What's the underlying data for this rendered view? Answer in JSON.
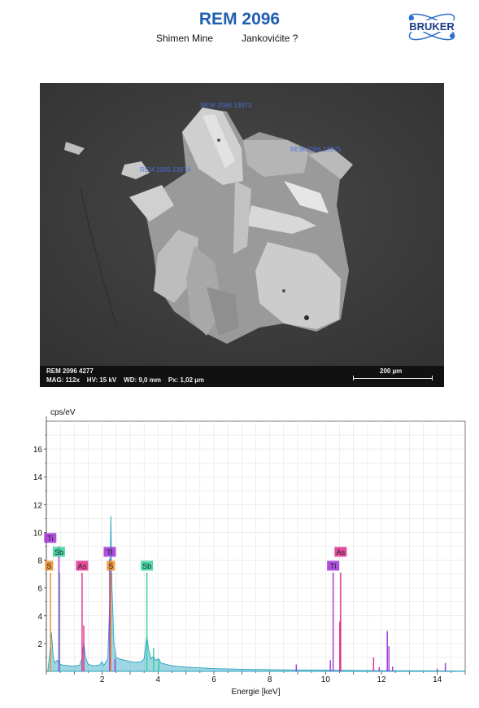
{
  "header": {
    "title": "REM 2096",
    "locality": "Shimen Mine",
    "mineral": "Jankovićite ?",
    "logo_text": "BRUKER"
  },
  "sem_image": {
    "labels": [
      "REM 2096 13973",
      "REM 2096 13975",
      "REM 2096 13974"
    ],
    "info_line1": "REM 2096 4277",
    "info_line2": "MAG: 112x    HV: 15 kV    WD: 9,0 mm    Px: 1,02 µm",
    "scale_label": "200 µm",
    "scale_bar_um": 200
  },
  "chart_data": {
    "type": "line",
    "ylabel": "cps/eV",
    "xlabel": "Energie [keV]",
    "xlim": [
      0,
      15
    ],
    "ylim": [
      0,
      18
    ],
    "x_ticks": [
      2,
      4,
      6,
      8,
      10,
      12,
      14
    ],
    "y_ticks": [
      2,
      4,
      6,
      8,
      10,
      12,
      14,
      16
    ],
    "grid": true,
    "series": [
      {
        "color": "#2aa3c0",
        "points": [
          [
            0.05,
            0
          ],
          [
            0.12,
            1.2
          ],
          [
            0.18,
            2.8
          ],
          [
            0.25,
            1.0
          ],
          [
            0.3,
            0.6
          ],
          [
            0.39,
            0.8
          ],
          [
            0.5,
            0.5
          ],
          [
            0.6,
            0.45
          ],
          [
            0.8,
            0.4
          ],
          [
            1.0,
            0.38
          ],
          [
            1.2,
            0.45
          ],
          [
            1.28,
            1.0
          ],
          [
            1.34,
            2.1
          ],
          [
            1.4,
            1.0
          ],
          [
            1.5,
            0.5
          ],
          [
            1.7,
            0.4
          ],
          [
            1.9,
            0.45
          ],
          [
            2.0,
            0.7
          ],
          [
            2.05,
            0.4
          ],
          [
            2.2,
            0.9
          ],
          [
            2.27,
            5.0
          ],
          [
            2.31,
            11.2
          ],
          [
            2.35,
            6.0
          ],
          [
            2.42,
            2.0
          ],
          [
            2.5,
            1.0
          ],
          [
            2.6,
            0.9
          ],
          [
            2.8,
            0.8
          ],
          [
            3.0,
            0.7
          ],
          [
            3.2,
            0.65
          ],
          [
            3.4,
            0.7
          ],
          [
            3.5,
            0.9
          ],
          [
            3.6,
            2.6
          ],
          [
            3.66,
            1.6
          ],
          [
            3.75,
            0.9
          ],
          [
            3.84,
            1.1
          ],
          [
            3.9,
            0.8
          ],
          [
            4.03,
            0.9
          ],
          [
            4.1,
            0.6
          ],
          [
            4.3,
            0.5
          ],
          [
            4.5,
            0.4
          ],
          [
            5.0,
            0.3
          ],
          [
            5.5,
            0.25
          ],
          [
            6.0,
            0.2
          ],
          [
            7.0,
            0.15
          ],
          [
            8.0,
            0.12
          ],
          [
            9.0,
            0.1
          ],
          [
            10.0,
            0.08
          ],
          [
            11.0,
            0.06
          ],
          [
            12.0,
            0.05
          ],
          [
            13.0,
            0.04
          ],
          [
            14.0,
            0.03
          ],
          [
            15.0,
            0.02
          ]
        ]
      }
    ],
    "element_markers": [
      {
        "label": "Ti",
        "color": "#a133d8",
        "lines": [
          0.45,
          4.51
        ]
      },
      {
        "label": "Sb",
        "color": "#2fd39a",
        "lines": [
          0.47,
          3.6
        ]
      },
      {
        "label": "S",
        "color": "#f08a22",
        "lines": [
          0.15,
          2.31
        ]
      },
      {
        "label": "As",
        "color": "#e02d8c",
        "lines": [
          1.28,
          10.54
        ]
      },
      {
        "label": "Tl",
        "color": "#a133d8",
        "lines": [
          2.27,
          10.27,
          12.21
        ]
      }
    ],
    "element_labels": [
      {
        "text": "Ti",
        "color": "#a133d8",
        "x": 0.14,
        "y": 9.6
      },
      {
        "text": "Sb",
        "color": "#2fd39a",
        "x": 0.45,
        "y": 8.6
      },
      {
        "text": "S",
        "color": "#f08a22",
        "x": 0.1,
        "y": 7.6
      },
      {
        "text": "As",
        "color": "#e02d8c",
        "x": 1.28,
        "y": 7.6
      },
      {
        "text": "Tl",
        "color": "#a133d8",
        "x": 2.27,
        "y": 8.6
      },
      {
        "text": "S",
        "color": "#f08a22",
        "x": 2.31,
        "y": 7.6
      },
      {
        "text": "Sb",
        "color": "#2fd39a",
        "x": 3.6,
        "y": 7.6
      },
      {
        "text": "Tl",
        "color": "#a133d8",
        "x": 10.27,
        "y": 7.6
      },
      {
        "text": "As",
        "color": "#e02d8c",
        "x": 10.54,
        "y": 8.6
      }
    ],
    "lines": [
      {
        "x": 0.15,
        "y": 7.1,
        "color": "#f08a22"
      },
      {
        "x": 0.47,
        "y": 7.1,
        "color": "#2fd39a"
      },
      {
        "x": 0.45,
        "y": 9.0,
        "color": "#a133d8"
      },
      {
        "x": 1.28,
        "y": 7.1,
        "color": "#e02d8c"
      },
      {
        "x": 1.34,
        "y": 3.3,
        "color": "#e02d8c"
      },
      {
        "x": 2.27,
        "y": 8.1,
        "color": "#a133d8"
      },
      {
        "x": 2.31,
        "y": 7.1,
        "color": "#f08a22"
      },
      {
        "x": 2.46,
        "y": 0.9,
        "color": "#a133d8"
      },
      {
        "x": 3.6,
        "y": 7.1,
        "color": "#2fd39a"
      },
      {
        "x": 3.84,
        "y": 1.7,
        "color": "#2fd39a"
      },
      {
        "x": 4.03,
        "y": 0.8,
        "color": "#2fd39a"
      },
      {
        "x": 8.95,
        "y": 0.5,
        "color": "#a133d8"
      },
      {
        "x": 10.27,
        "y": 7.1,
        "color": "#a133d8"
      },
      {
        "x": 10.17,
        "y": 0.8,
        "color": "#a133d8"
      },
      {
        "x": 10.54,
        "y": 7.1,
        "color": "#e02d8c"
      },
      {
        "x": 10.51,
        "y": 3.6,
        "color": "#e02d8c"
      },
      {
        "x": 11.72,
        "y": 1.0,
        "color": "#e02d8c"
      },
      {
        "x": 11.92,
        "y": 0.3,
        "color": "#a133d8"
      },
      {
        "x": 12.21,
        "y": 2.9,
        "color": "#a133d8"
      },
      {
        "x": 12.27,
        "y": 1.8,
        "color": "#a133d8"
      },
      {
        "x": 12.4,
        "y": 0.35,
        "color": "#a133d8"
      },
      {
        "x": 14.29,
        "y": 0.6,
        "color": "#a133d8"
      },
      {
        "x": 14.0,
        "y": 0.2,
        "color": "#a133d8"
      }
    ]
  }
}
